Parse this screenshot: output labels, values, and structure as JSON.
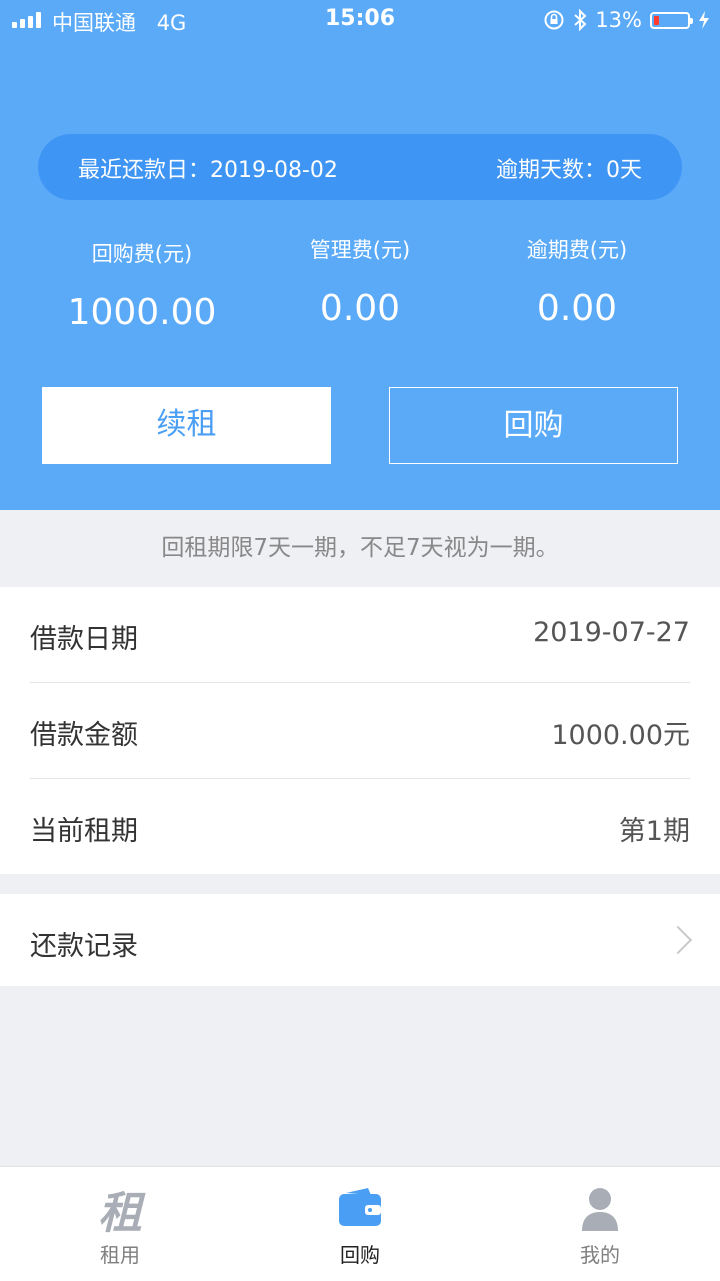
{
  "status_bar": {
    "carrier": "中国联通",
    "network": "4G",
    "time": "15:06",
    "battery": "13%"
  },
  "summary": {
    "recent_due_date_label": "最近还款日：",
    "recent_due_date": "2019-08-02",
    "overdue_days_label": "逾期天数：",
    "overdue_days": "0天"
  },
  "fees": [
    {
      "label": "回购费(元)",
      "value": "1000.00"
    },
    {
      "label": "管理费(元)",
      "value": "0.00"
    },
    {
      "label": "逾期费(元)",
      "value": "0.00"
    }
  ],
  "actions": {
    "renew": "续租",
    "buyback": "回购"
  },
  "notice": "回租期限7天一期，不足7天视为一期。",
  "details": [
    {
      "label": "借款日期",
      "value": "2019-07-27"
    },
    {
      "label": "借款金额",
      "value": "1000.00元"
    },
    {
      "label": "当前租期",
      "value": "第1期"
    }
  ],
  "repayment_record": "还款记录",
  "tabs": [
    {
      "label": "租用",
      "icon_glyph": "租",
      "icon": "rent-icon"
    },
    {
      "label": "回购",
      "icon": "wallet-icon"
    },
    {
      "label": "我的",
      "icon": "person-icon"
    }
  ],
  "colors": {
    "primary": "#5aaaf8",
    "pill": "#3f95f3",
    "accent": "#4a9ff5"
  }
}
